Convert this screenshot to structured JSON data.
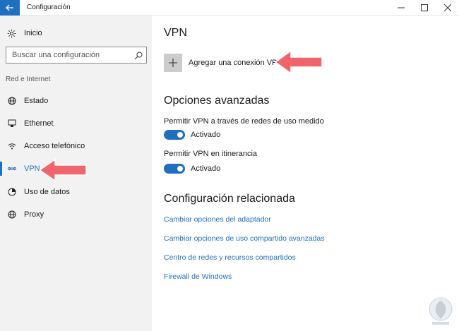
{
  "window": {
    "title": "Configuración",
    "accent": "#1f6fbf"
  },
  "sidebar": {
    "home_label": "Inicio",
    "search_placeholder": "Buscar una configuración",
    "group_label": "Red e Internet",
    "items": [
      {
        "label": "Estado",
        "icon": "globe-icon",
        "active": false
      },
      {
        "label": "Ethernet",
        "icon": "ethernet-icon",
        "active": false
      },
      {
        "label": "Acceso telefónico",
        "icon": "dialup-icon",
        "active": false
      },
      {
        "label": "VPN",
        "icon": "vpn-icon",
        "active": true
      },
      {
        "label": "Uso de datos",
        "icon": "data-usage-icon",
        "active": false
      },
      {
        "label": "Proxy",
        "icon": "globe-icon",
        "active": false
      }
    ]
  },
  "main": {
    "title": "VPN",
    "add_vpn_label": "Agregar una conexión VPN",
    "advanced_title": "Opciones avanzadas",
    "options": [
      {
        "label": "Permitir VPN a través de redes de uso medido",
        "state": "Activado",
        "on": true
      },
      {
        "label": "Permitir VPN en itinerancia",
        "state": "Activado",
        "on": true
      }
    ],
    "related_title": "Configuración relacionada",
    "links": [
      "Cambiar opciones del adaptador",
      "Cambiar opciones de uso compartido avanzadas",
      "Centro de redes y recursos compartidos",
      "Firewall de Windows"
    ]
  },
  "annotation_color": "#f0656b"
}
